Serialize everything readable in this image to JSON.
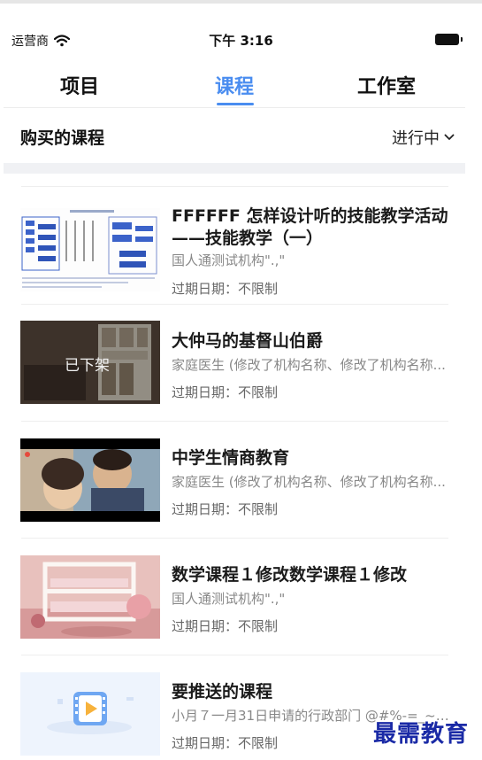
{
  "status_bar": {
    "carrier": "运营商",
    "time": "下午 3:16"
  },
  "tabs": [
    {
      "label": "项目",
      "active": false
    },
    {
      "label": "课程",
      "active": true
    },
    {
      "label": "工作室",
      "active": false
    }
  ],
  "section": {
    "title": "购买的课程",
    "filter_label": "进行中"
  },
  "courses": [
    {
      "title": "FFFFFF 怎样设计听的技能教学活动——技能教学（一）",
      "org": "国人通测试机构\".,\"",
      "expiry": "过期日期：不限制",
      "thumb_label": ""
    },
    {
      "title": "大仲马的基督山伯爵",
      "org": "家庭医生 (修改了机构名称、修改了机构名称...",
      "expiry": "过期日期：不限制",
      "thumb_label": "已下架"
    },
    {
      "title": "中学生情商教育",
      "org": "家庭医生 (修改了机构名称、修改了机构名称...",
      "expiry": "过期日期：不限制",
      "thumb_label": ""
    },
    {
      "title": "数学课程１修改数学课程１修改",
      "org": "国人通测试机构\".,\"",
      "expiry": "过期日期：不限制",
      "thumb_label": ""
    },
    {
      "title": "要推送的课程",
      "org": "小月７一月31日申请的行政部门 @#%-=_~[];....",
      "expiry": "过期日期：不限制",
      "thumb_label": ""
    }
  ],
  "watermark": "最需教育",
  "colors": {
    "accent": "#4a8df0",
    "watermark": "#1a2aa6"
  }
}
